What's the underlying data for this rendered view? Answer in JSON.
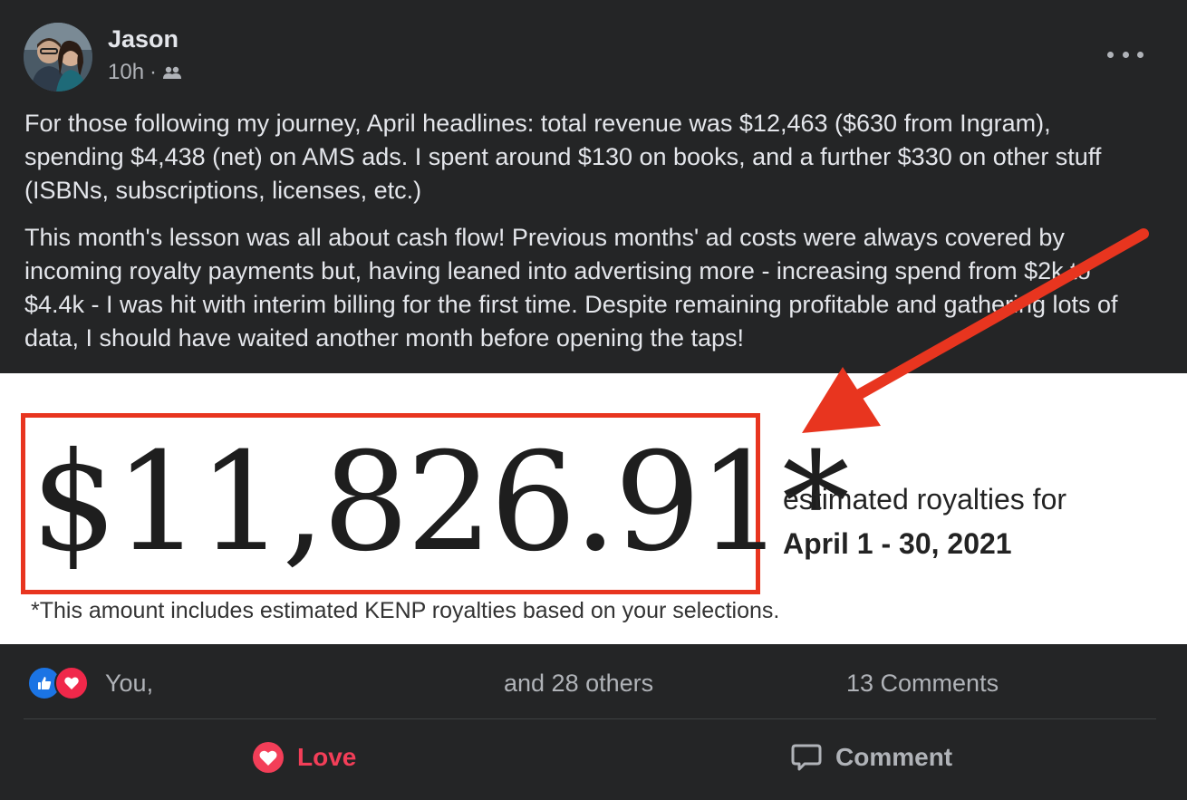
{
  "post": {
    "author": "Jason",
    "time": "10h",
    "separator": "·",
    "audience_icon": "friends-icon",
    "more_icon": "more-options-icon",
    "paragraphs": [
      "For those following my journey, April headlines: total revenue was $12,463 ($630 from Ingram), spending $4,438 (net) on AMS ads. I spent around $130 on books, and a further $330 on other stuff (ISBNs, subscriptions, licenses, etc.)",
      "This month's lesson was all about cash flow! Previous months' ad costs were always covered by incoming royalty payments but, having leaned into advertising more - increasing spend from $2k to $4.4k - I was hit with interim billing for the first time. Despite remaining profitable and gathering lots of data, I should have waited another month before opening the taps!"
    ]
  },
  "image": {
    "amount": "$11,826.91*",
    "label": "estimated royalties for",
    "date_range": "April 1 - 30, 2021",
    "footnote": "*This amount includes estimated KENP royalties based on your selections.",
    "highlight_color": "#e8351f"
  },
  "engagement": {
    "reaction_icons": [
      "like-icon",
      "love-icon"
    ],
    "you_text": "You,",
    "others_text": "and 28 others",
    "comments_text": "13 Comments"
  },
  "actions": {
    "love_label": "Love",
    "comment_label": "Comment"
  },
  "colors": {
    "background": "#242526",
    "love": "#f33e58",
    "like": "#1b74e4"
  }
}
